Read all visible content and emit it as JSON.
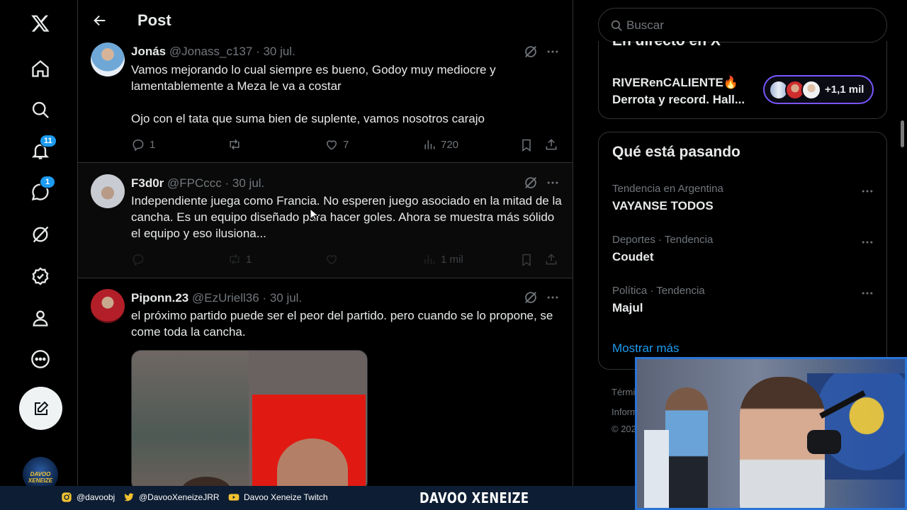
{
  "nav": {
    "items": [
      {
        "name": "home",
        "icon": "home-icon"
      },
      {
        "name": "explore",
        "icon": "search-icon"
      },
      {
        "name": "notifications",
        "icon": "bell-icon",
        "badge": "11"
      },
      {
        "name": "messages",
        "icon": "message-icon",
        "badge": "1"
      },
      {
        "name": "grok",
        "icon": "grok-icon"
      },
      {
        "name": "verified",
        "icon": "verified-icon"
      },
      {
        "name": "profile",
        "icon": "person-icon"
      },
      {
        "name": "more",
        "icon": "more-circle-icon"
      }
    ],
    "compose_icon": "compose-icon",
    "avatar_text": "DAVOO XENEIZE"
  },
  "header": {
    "title": "Post"
  },
  "tweets": [
    {
      "name": "Jonás",
      "handle": "@Jonass_c137",
      "date": "· 30 jul.",
      "text": "Vamos mejorando lo cual siempre es bueno, Godoy muy mediocre y lamentablemente a Meza le va a costar\n\nOjo con el tata que suma bien de suplente, vamos nosotros carajo",
      "replies": "1",
      "retweets": "",
      "likes": "7",
      "views": "720"
    },
    {
      "name": "F3d0r",
      "handle": "@FPCccc",
      "date": "· 30 jul.",
      "text": "Independiente juega como Francia. No esperen juego asociado en la mitad de la cancha. Es un equipo diseñado para hacer goles. Ahora se muestra más sólido el equipo y eso ilusiona...",
      "replies": "",
      "retweets": "1",
      "likes": "",
      "views": "1 mil"
    },
    {
      "name": "Piponn.23",
      "handle": "@EzUriell36",
      "date": "· 30 jul.",
      "text": "el próximo partido puede ser el peor del partido. pero cuando se lo propone, se come toda la cancha."
    }
  ],
  "search": {
    "placeholder": "Buscar"
  },
  "live": {
    "title": "En directo en X",
    "host": "RIVERenCALIENTE🔥",
    "description": "Derrota y record. Hall...",
    "count": "+1,1 mil"
  },
  "trends": {
    "title": "Qué está pasando",
    "items": [
      {
        "meta": "Tendencia en Argentina",
        "name": "VAYANSE TODOS"
      },
      {
        "meta": "Deportes · Tendencia",
        "name": "Coudet"
      },
      {
        "meta": "Política · Tendencia",
        "name": "Majul"
      }
    ],
    "show_more": "Mostrar más"
  },
  "footer": {
    "line1": "Térmi",
    "line2": "Inform",
    "line3": "© 202"
  },
  "banner": {
    "instagram": "@davoobj",
    "twitter": "@DavooXeneizeJRR",
    "twitch": "Davoo Xeneize Twitch",
    "brand": "DAVOO XENEIZE"
  },
  "colors": {
    "accent": "#1d9bf0",
    "background": "#000000",
    "border": "#2f3336",
    "muted": "#71767b",
    "live_pill": "#7856ff"
  }
}
